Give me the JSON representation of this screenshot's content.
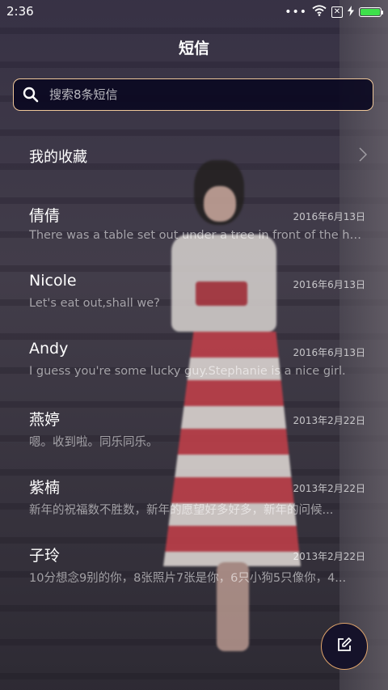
{
  "status_bar": {
    "time": "2:36",
    "battery_level": 1.0
  },
  "header": {
    "title": "短信"
  },
  "search": {
    "placeholder": "搜索8条短信"
  },
  "favorites": {
    "label": "我的收藏"
  },
  "messages": [
    {
      "name": "倩倩",
      "date": "2016年6月13日",
      "preview": "There was a table set out under a tree in front of the ho..."
    },
    {
      "name": "Nicole",
      "date": "2016年6月13日",
      "preview": "Let's eat out,shall we?"
    },
    {
      "name": "Andy",
      "date": "2016年6月13日",
      "preview": "I guess you're some lucky guy.Stephanie is a nice girl."
    },
    {
      "name": "燕婷",
      "date": "2013年2月22日",
      "preview": "嗯。收到啦。同乐同乐。"
    },
    {
      "name": "紫楠",
      "date": "2013年2月22日",
      "preview": "新年的祝福数不胜数，新年的愿望好多好多，新年的问候..."
    },
    {
      "name": "子玲",
      "date": "2013年2月22日",
      "preview": "10分想念9别的你，8张照片7张是你，6只小狗5只像你，4..."
    }
  ],
  "icons": {
    "search": "search-icon",
    "chevron": "chevron-right-icon",
    "compose": "compose-icon",
    "wifi": "wifi-icon",
    "battery": "battery-icon",
    "charging": "charging-icon"
  },
  "colors": {
    "accent": "#e0a46a",
    "battery": "#3ee04b"
  }
}
